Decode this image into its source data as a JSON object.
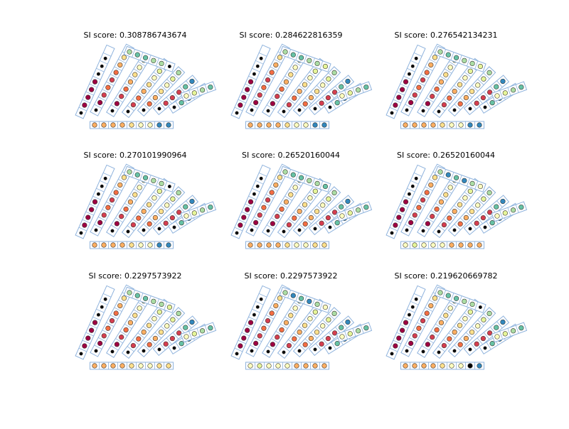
{
  "palette": {
    "frame_stroke": "#8fb3dd",
    "circle_stroke": "#333333",
    "colors": [
      "#000000",
      "#9e0142",
      "#d53e4f",
      "#f46d43",
      "#fdae61",
      "#fee08b",
      "#ffffbf",
      "#e6f598",
      "#abdda4",
      "#66c2a5",
      "#3288bd",
      "#5e4fa2"
    ]
  },
  "panels": [
    {
      "title": "SI score: 0.308786743674",
      "rows": [
        [
          0,
          1,
          1,
          1,
          1,
          0,
          0,
          0
        ],
        [
          0,
          1,
          2,
          3,
          2,
          3,
          4,
          5,
          3
        ],
        [
          0,
          1,
          2,
          3,
          4,
          5,
          6,
          7
        ],
        [
          0,
          2,
          3,
          4,
          5,
          6,
          7,
          8
        ],
        [
          0,
          3,
          4,
          5,
          6,
          7,
          8
        ],
        [
          0,
          2,
          2,
          2,
          9,
          10
        ],
        [
          0,
          9,
          10,
          11,
          9
        ],
        [
          6,
          7,
          8,
          9
        ],
        [
          8,
          9,
          9,
          8,
          8,
          0
        ]
      ],
      "bottom": [
        4,
        4,
        4,
        4,
        5,
        6,
        6,
        10,
        10
      ]
    },
    {
      "title": "SI score: 0.284622816359",
      "rows": [
        [
          0,
          1,
          1,
          1,
          1,
          0,
          0,
          0
        ],
        [
          0,
          1,
          2,
          3,
          2,
          3,
          4,
          5,
          3
        ],
        [
          0,
          1,
          2,
          3,
          4,
          5,
          6,
          7
        ],
        [
          0,
          2,
          3,
          4,
          5,
          6,
          7,
          8
        ],
        [
          0,
          3,
          4,
          5,
          6,
          7,
          8
        ],
        [
          0,
          2,
          2,
          2,
          9,
          10
        ],
        [
          0,
          9,
          10,
          11,
          9
        ],
        [
          6,
          7,
          8,
          9
        ],
        [
          8,
          9,
          9,
          8,
          8,
          7
        ]
      ],
      "bottom": [
        4,
        4,
        4,
        4,
        5,
        6,
        6,
        10,
        10
      ]
    },
    {
      "title": "SI score: 0.276542134231",
      "rows": [
        [
          0,
          1,
          1,
          1,
          1,
          0,
          0,
          0
        ],
        [
          0,
          1,
          2,
          3,
          2,
          3,
          4,
          5,
          3
        ],
        [
          0,
          1,
          2,
          3,
          4,
          5,
          6,
          7
        ],
        [
          0,
          2,
          3,
          4,
          5,
          6,
          7,
          8
        ],
        [
          0,
          3,
          4,
          5,
          6,
          7,
          8
        ],
        [
          0,
          2,
          2,
          2,
          9,
          10
        ],
        [
          0,
          9,
          10,
          11,
          9
        ],
        [
          6,
          7,
          8,
          9
        ],
        [
          8,
          9,
          9,
          8,
          8,
          7
        ]
      ],
      "bottom": [
        4,
        4,
        4,
        4,
        5,
        6,
        6,
        10,
        10
      ]
    },
    {
      "title": "SI score: 0.270101990964",
      "rows": [
        [
          0,
          1,
          1,
          1,
          1,
          0,
          0,
          0
        ],
        [
          0,
          1,
          2,
          3,
          2,
          3,
          4,
          5,
          3
        ],
        [
          0,
          1,
          2,
          3,
          4,
          5,
          6,
          7
        ],
        [
          0,
          2,
          3,
          4,
          5,
          6,
          7,
          8
        ],
        [
          0,
          3,
          4,
          5,
          6,
          7,
          8
        ],
        [
          0,
          2,
          2,
          2,
          9,
          10
        ],
        [
          0,
          9,
          10,
          11,
          9
        ],
        [
          6,
          7,
          8,
          9
        ],
        [
          8,
          9,
          9,
          8,
          8,
          0
        ]
      ],
      "bottom": [
        4,
        4,
        4,
        4,
        5,
        6,
        6,
        10,
        10
      ]
    },
    {
      "title": "SI score: 0.26520160044",
      "rows": [
        [
          0,
          1,
          1,
          1,
          1,
          0,
          0,
          0
        ],
        [
          0,
          1,
          2,
          3,
          2,
          3,
          4,
          5,
          3
        ],
        [
          0,
          1,
          2,
          3,
          4,
          5,
          6,
          7
        ],
        [
          0,
          2,
          3,
          4,
          5,
          6,
          7,
          8
        ],
        [
          0,
          3,
          4,
          5,
          6,
          7,
          8
        ],
        [
          0,
          2,
          2,
          2,
          9,
          10
        ],
        [
          0,
          9,
          10,
          11,
          9
        ],
        [
          6,
          7,
          8,
          9
        ],
        [
          8,
          9,
          9,
          8,
          8,
          9
        ]
      ],
      "bottom": [
        4,
        4,
        4,
        4,
        5,
        6,
        6,
        5,
        5
      ]
    },
    {
      "title": "SI score: 0.26520160044",
      "rows": [
        [
          0,
          1,
          1,
          1,
          1,
          0,
          0,
          0
        ],
        [
          0,
          1,
          2,
          3,
          2,
          3,
          4,
          5,
          3
        ],
        [
          0,
          1,
          2,
          3,
          4,
          5,
          6,
          7
        ],
        [
          0,
          2,
          3,
          4,
          5,
          6,
          7,
          8
        ],
        [
          0,
          3,
          4,
          5,
          6,
          7,
          8
        ],
        [
          0,
          2,
          2,
          2,
          9,
          10
        ],
        [
          0,
          9,
          10,
          11,
          9
        ],
        [
          6,
          7,
          8,
          9
        ],
        [
          8,
          10,
          9,
          10,
          8,
          6
        ]
      ],
      "bottom": [
        6,
        7,
        6,
        6,
        6,
        4,
        4,
        4,
        4
      ]
    },
    {
      "title": "SI score: 0.2297573922",
      "rows": [
        [
          0,
          1,
          1,
          1,
          1,
          0,
          0,
          0
        ],
        [
          0,
          1,
          2,
          3,
          2,
          3,
          4,
          5,
          3
        ],
        [
          0,
          1,
          2,
          3,
          4,
          5,
          6,
          7
        ],
        [
          0,
          2,
          3,
          4,
          5,
          6,
          7,
          8
        ],
        [
          0,
          3,
          4,
          5,
          6,
          7,
          8
        ],
        [
          0,
          2,
          2,
          2,
          9,
          10
        ],
        [
          0,
          9,
          10,
          11,
          9
        ],
        [
          6,
          7,
          8,
          9
        ],
        [
          8,
          9,
          9,
          8,
          8,
          7
        ]
      ],
      "bottom": [
        4,
        4,
        4,
        4,
        5,
        6,
        6,
        5,
        5
      ]
    },
    {
      "title": "SI score: 0.2297573922",
      "rows": [
        [
          0,
          1,
          1,
          1,
          1,
          0,
          0,
          0
        ],
        [
          0,
          1,
          2,
          3,
          2,
          3,
          4,
          5,
          3
        ],
        [
          0,
          1,
          2,
          3,
          4,
          5,
          6,
          7
        ],
        [
          0,
          2,
          3,
          4,
          5,
          6,
          7,
          8
        ],
        [
          0,
          3,
          4,
          5,
          6,
          7,
          8
        ],
        [
          0,
          2,
          2,
          2,
          9,
          10
        ],
        [
          0,
          9,
          10,
          11,
          9
        ],
        [
          6,
          7,
          8,
          9
        ],
        [
          8,
          10,
          9,
          10,
          8,
          6
        ]
      ],
      "bottom": [
        6,
        7,
        6,
        6,
        6,
        4,
        4,
        4,
        4
      ]
    },
    {
      "title": "SI score: 0.219620669782",
      "rows": [
        [
          0,
          1,
          1,
          1,
          1,
          0,
          0,
          0
        ],
        [
          0,
          1,
          2,
          3,
          2,
          3,
          4,
          5,
          3
        ],
        [
          0,
          1,
          2,
          3,
          4,
          5,
          6,
          7
        ],
        [
          0,
          2,
          3,
          4,
          5,
          6,
          7,
          8
        ],
        [
          0,
          3,
          4,
          5,
          6,
          7,
          8
        ],
        [
          0,
          2,
          2,
          2,
          9,
          10
        ],
        [
          0,
          9,
          10,
          11,
          9
        ],
        [
          6,
          7,
          8,
          9
        ],
        [
          8,
          9,
          9,
          8,
          8,
          0
        ]
      ],
      "bottom": [
        4,
        4,
        4,
        4,
        5,
        6,
        6,
        0,
        10
      ]
    }
  ]
}
